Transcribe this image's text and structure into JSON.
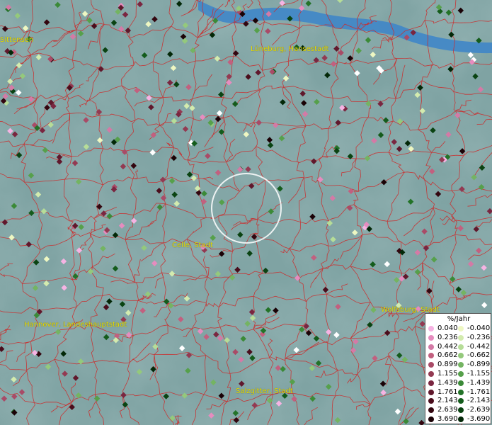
{
  "legend": {
    "title": "%/Jahr",
    "left": [
      {
        "label": "0.040",
        "color": "#f6b3e3"
      },
      {
        "label": "0.236",
        "color": "#e68cbf"
      },
      {
        "label": "0.442",
        "color": "#d47aa6"
      },
      {
        "label": "0.662",
        "color": "#c2607f"
      },
      {
        "label": "0.899",
        "color": "#a94b67"
      },
      {
        "label": "1.155",
        "color": "#933a52"
      },
      {
        "label": "1.439",
        "color": "#7a2640"
      },
      {
        "label": "1.761",
        "color": "#60182c"
      },
      {
        "label": "2.143",
        "color": "#4a0d1c"
      },
      {
        "label": "2.639",
        "color": "#33060f"
      },
      {
        "label": "3.690",
        "color": "#1a0206"
      }
    ],
    "right": [
      {
        "label": "-0.040",
        "color": "#eef7c2"
      },
      {
        "label": "-0.236",
        "color": "#d3ebae"
      },
      {
        "label": "-0.442",
        "color": "#b6dd98"
      },
      {
        "label": "-0.662",
        "color": "#94c97c"
      },
      {
        "label": "-0.899",
        "color": "#74b462"
      },
      {
        "label": "-1.155",
        "color": "#56a04b"
      },
      {
        "label": "-1.439",
        "color": "#3b8a38"
      },
      {
        "label": "-1.761",
        "color": "#237328"
      },
      {
        "label": "-2.143",
        "color": "#145c1c"
      },
      {
        "label": "-2.639",
        "color": "#0a4312"
      },
      {
        "label": "-3.690",
        "color": "#032808"
      }
    ]
  },
  "cities": [
    {
      "name": "Sittensen"
    },
    {
      "name": "Lüneburg, Hansestadt"
    },
    {
      "name": "Celle, Stadt"
    },
    {
      "name": "Hannover, Landeshauptstadt"
    },
    {
      "name": "Wolfsburg, Stadt"
    },
    {
      "name": "Salzgitter, Stadt"
    }
  ],
  "colors": {
    "background": "#7fa3a3",
    "river": "#3f86c8",
    "boundary": "#cc2b2b",
    "label": "#e8e000",
    "highlight_circle": "#ffffff"
  }
}
